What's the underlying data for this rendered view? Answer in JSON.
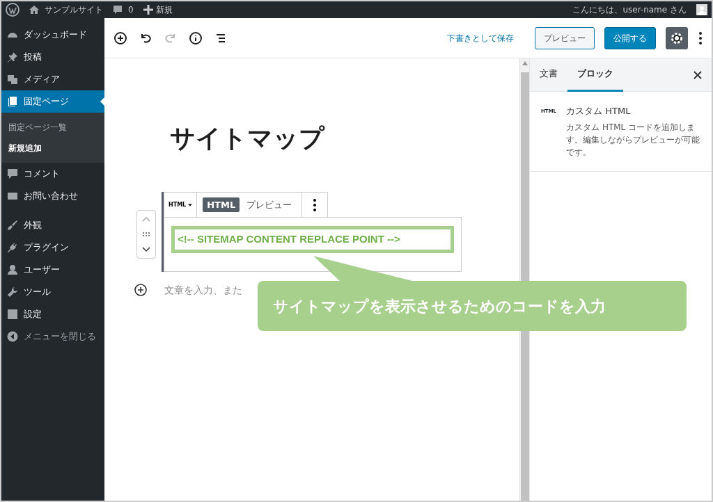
{
  "admin_bar": {
    "site_name": "サンプルサイト",
    "comment_count": "0",
    "new_label": "新規",
    "greeting": "こんにちは、user-name さん"
  },
  "sidebar": {
    "items": [
      {
        "label": "ダッシュボード",
        "selected": false
      },
      {
        "label": "投稿",
        "selected": false
      },
      {
        "label": "メディア",
        "selected": false
      },
      {
        "label": "固定ページ",
        "selected": true,
        "children": [
          {
            "label": "固定ページ一覧",
            "selected": false
          },
          {
            "label": "新規追加",
            "selected": true
          }
        ]
      },
      {
        "label": "コメント",
        "selected": false
      },
      {
        "label": "お問い合わせ",
        "selected": false
      },
      {
        "label": "外観",
        "selected": false
      },
      {
        "label": "プラグイン",
        "selected": false
      },
      {
        "label": "ユーザー",
        "selected": false
      },
      {
        "label": "ツール",
        "selected": false
      },
      {
        "label": "設定",
        "selected": false
      }
    ],
    "collapse_label": "メニューを閉じる"
  },
  "editor_toolbar": {
    "save_draft": "下書きとして保存",
    "preview": "プレビュー",
    "publish": "公開する",
    "settings_active": true,
    "redo_disabled": true
  },
  "document": {
    "title": "サイトマップ",
    "block": {
      "type_label": "HTML",
      "tabs": [
        {
          "label": "HTML",
          "selected": true
        },
        {
          "label": "プレビュー",
          "selected": false
        }
      ],
      "code": "<!-- SITEMAP CONTENT REPLACE POINT -->"
    },
    "appender_placeholder": "文章を入力、また"
  },
  "callout": "サイトマップを表示させるためのコードを入力",
  "settings_panel": {
    "tabs": [
      {
        "label": "文書",
        "selected": false
      },
      {
        "label": "ブロック",
        "selected": true
      }
    ],
    "block_icon_label": "HTML",
    "block_name": "カスタム HTML",
    "block_description": "カスタム HTML コードを追加します。編集しながらプレビューが可能です。"
  }
}
